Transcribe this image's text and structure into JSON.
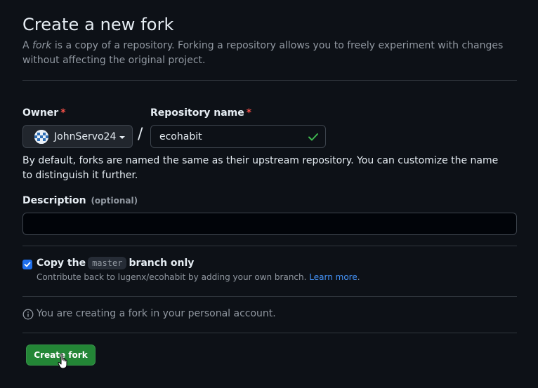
{
  "header": {
    "title": "Create a new fork",
    "subtitle_prefix": "A ",
    "subtitle_em": "fork",
    "subtitle_rest": " is a copy of a repository. Forking a repository allows you to freely experiment with changes without affecting the original project."
  },
  "owner": {
    "label": "Owner",
    "required_mark": "*",
    "value": "JohnServo24",
    "icon": "chevron-down-icon"
  },
  "separator": "/",
  "repository": {
    "label": "Repository name",
    "required_mark": "*",
    "value": "ecohabit",
    "status_icon": "check-icon",
    "status_color": "#3fb950"
  },
  "repo_help": "By default, forks are named the same as their upstream repository. You can customize the name to distinguish it further.",
  "description": {
    "label": "Description",
    "optional": "(optional)",
    "value": "",
    "placeholder": ""
  },
  "copy_branch": {
    "checked": true,
    "label_before": "Copy the",
    "branch": "master",
    "label_after": "branch only",
    "help_text": "Contribute back to lugenx/ecohabit by adding your own branch.",
    "link_text": "Learn more"
  },
  "info": {
    "icon": "info-icon",
    "text": "You are creating a fork in your personal account."
  },
  "actions": {
    "create_label": "Create fork",
    "create_color": "#238636"
  },
  "theme": {
    "background": "#0d1117",
    "accent": "#1f6feb",
    "link": "#4493f8",
    "danger": "#f85149"
  }
}
